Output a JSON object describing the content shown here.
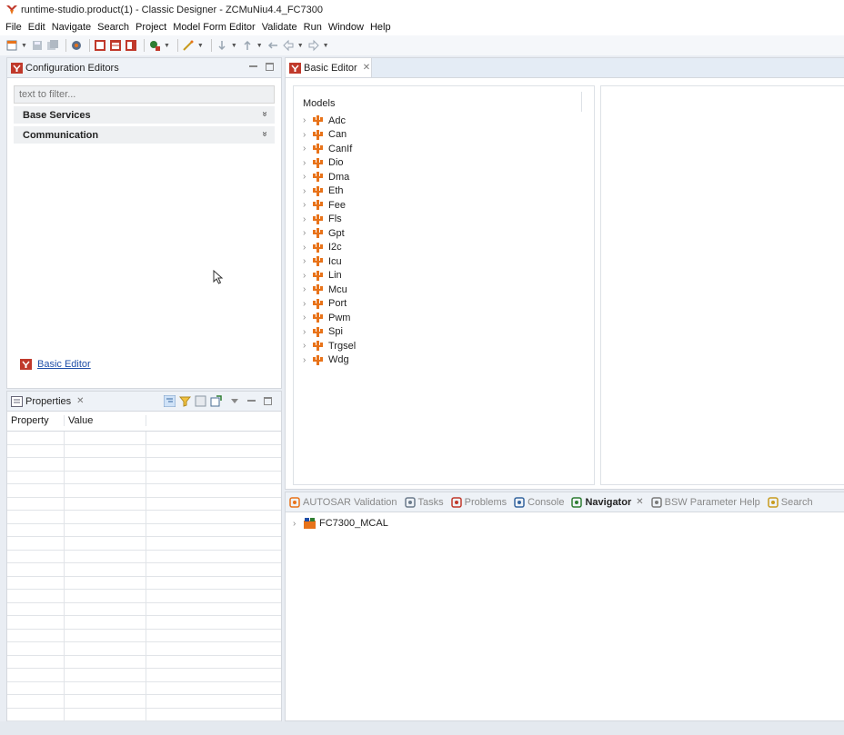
{
  "window": {
    "title": "runtime-studio.product(1) - Classic Designer - ZCMuNiu4.4_FC7300"
  },
  "menu": [
    "File",
    "Edit",
    "Navigate",
    "Search",
    "Project",
    "Model Form Editor",
    "Validate",
    "Run",
    "Window",
    "Help"
  ],
  "config_editors": {
    "title": "Configuration Editors",
    "filter_placeholder": "text to filter...",
    "sections": [
      "Base Services",
      "Communication"
    ],
    "expand_glyph": "»",
    "link_label": "Basic Editor"
  },
  "properties": {
    "title": "Properties",
    "columns": [
      "Property",
      "Value",
      ""
    ]
  },
  "editor": {
    "tab_label": "Basic Editor",
    "models_heading": "Models",
    "models": [
      "Adc",
      "Can",
      "CanIf",
      "Dio",
      "Dma",
      "Eth",
      "Fee",
      "Fls",
      "Gpt",
      "I2c",
      "Icu",
      "Lin",
      "Mcu",
      "Port",
      "Pwm",
      "Spi",
      "Trgsel",
      "Wdg"
    ]
  },
  "views": {
    "tabs": [
      {
        "label": "AUTOSAR Validation",
        "icon": "validation-icon",
        "active": false
      },
      {
        "label": "Tasks",
        "icon": "tasks-icon",
        "active": false
      },
      {
        "label": "Problems",
        "icon": "problems-icon",
        "active": false
      },
      {
        "label": "Console",
        "icon": "console-icon",
        "active": false
      },
      {
        "label": "Navigator",
        "icon": "navigator-icon",
        "active": true
      },
      {
        "label": "BSW Parameter Help",
        "icon": "help-icon",
        "active": false
      },
      {
        "label": "Search",
        "icon": "search-icon",
        "active": false
      }
    ],
    "tree_root": "FC7300_MCAL"
  },
  "glyphs": {
    "close": "✕",
    "tree_arrow": "›"
  },
  "colors": {
    "accent_orange": "#e8731a",
    "brand_red": "#c0392b",
    "link_blue": "#1f4fa8"
  }
}
